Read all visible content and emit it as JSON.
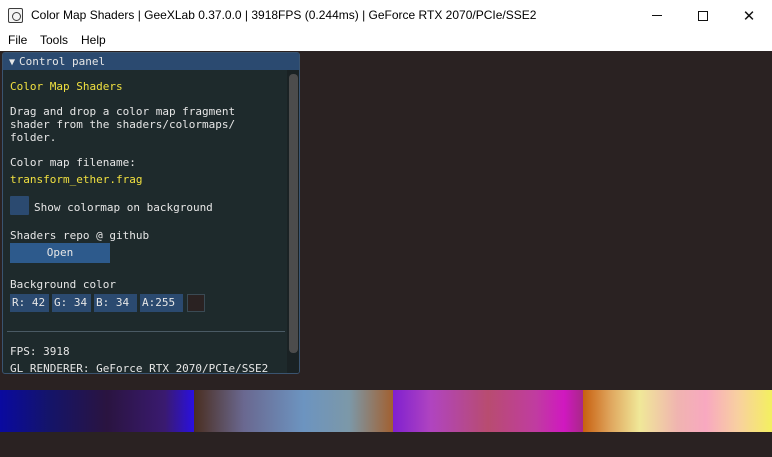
{
  "window": {
    "title": "Color Map Shaders | GeeXLab 0.37.0.0 | 3918FPS (0.244ms) | GeForce RTX 2070/PCIe/SSE2",
    "icon": "geexlab-icon"
  },
  "menu": {
    "items": [
      "File",
      "Tools",
      "Help"
    ]
  },
  "panel": {
    "title": "Control panel",
    "heading": "Color Map Shaders",
    "description_lines": [
      "Drag and drop a color map fragment",
      "shader from the shaders/colormaps/",
      "folder."
    ],
    "filename_label": "Color map filename:",
    "filename": "transform_ether.frag",
    "checkbox_label": "Show colormap on background",
    "checkbox_checked": false,
    "repo_label": "Shaders repo @ github",
    "open_button": "Open",
    "bg_label": "Background color",
    "bg": {
      "r": "R: 42",
      "g": "G: 34",
      "b": "B: 34",
      "a": "A:255"
    },
    "bg_color": "#2a2222",
    "fps": "FPS: 3918",
    "renderer": "GL_RENDERER: GeForce RTX 2070/PCIe/SSE2"
  },
  "colormaps": [
    {
      "name": "blue-purple",
      "gradient": "linear-gradient(90deg,#0a0aa0 0%,#14146a 25%,#2a1440 55%,#3a1a70 85%,#2a10e0 100%)"
    },
    {
      "name": "brown-steel",
      "gradient": "linear-gradient(90deg,#4a2e20 0%,#6a6890 25%,#6c94c0 55%,#7c98a8 78%,#a26030 100%)"
    },
    {
      "name": "violet-magenta",
      "gradient": "linear-gradient(90deg,#8020d0 0%,#b044c0 20%,#b84c70 50%,#c03ca0 75%,#d018c0 90%,#a82888 100%)"
    },
    {
      "name": "orange-pink-yellow",
      "gradient": "linear-gradient(90deg,#c86010 0%,#e0a860 15%,#f0e898 30%,#f0b4b0 50%,#f8a8c0 65%,#f8d0a0 82%,#f4f060 100%)"
    }
  ]
}
